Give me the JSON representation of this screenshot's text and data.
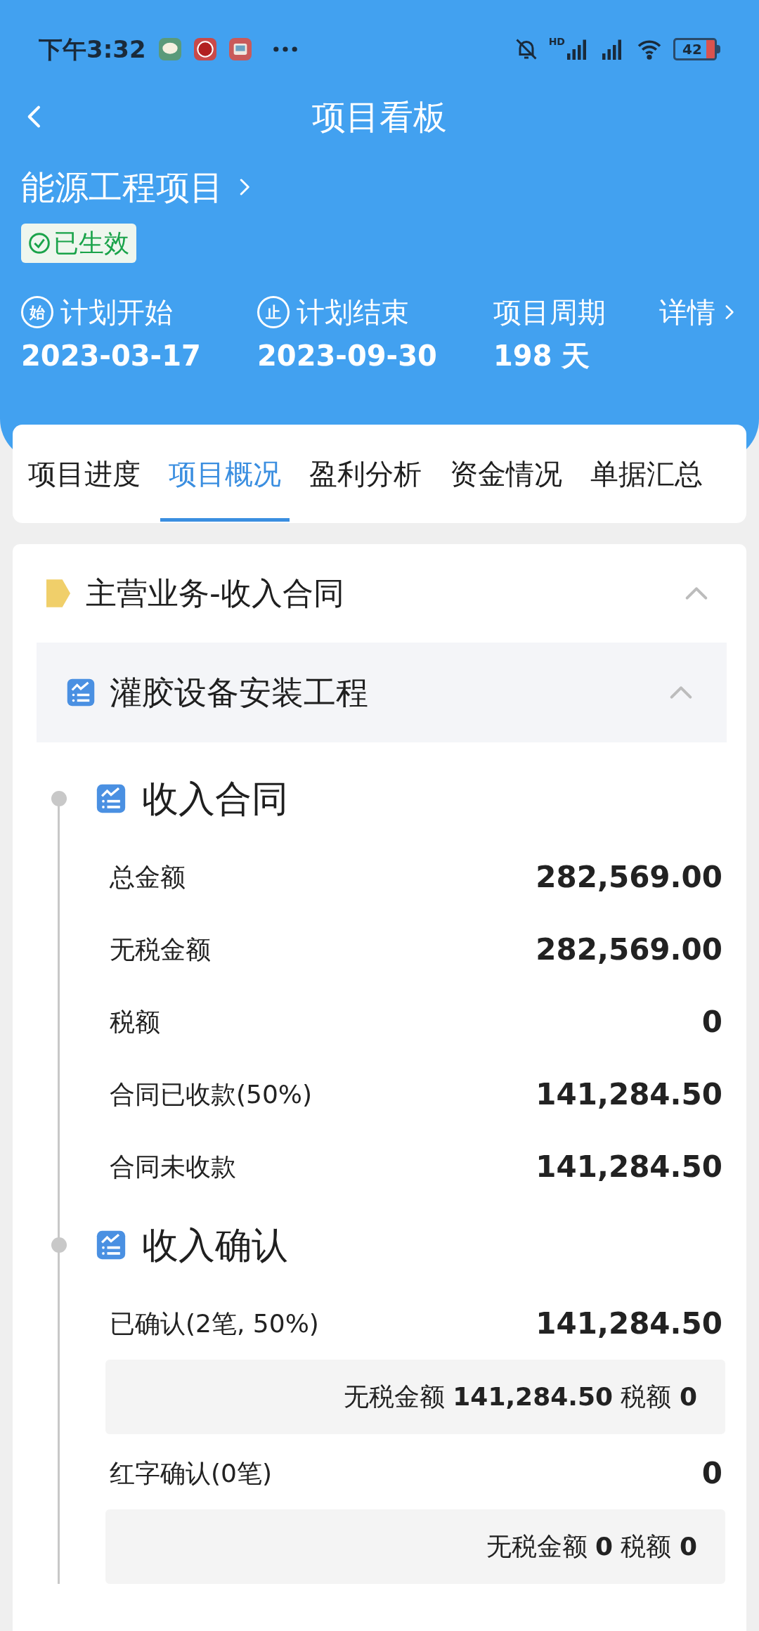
{
  "status_bar": {
    "time": "下午3:32",
    "battery": "42",
    "network_label": "HD"
  },
  "header": {
    "title": "项目看板",
    "project": "能源工程项目",
    "status": {
      "label": "已生效",
      "color": "#1aa34a"
    }
  },
  "schedule": [
    {
      "kind": "start",
      "icon_text": "始",
      "label": "计划开始",
      "value": "2023-03-17"
    },
    {
      "kind": "end",
      "icon_text": "止",
      "label": "计划结束",
      "value": "2023-09-30"
    },
    {
      "kind": "plain",
      "label": "项目周期",
      "value": "198 天"
    }
  ],
  "details_link": "详情",
  "tabs": [
    {
      "label": "项目进度",
      "selected": false
    },
    {
      "label": "项目概况",
      "selected": true
    },
    {
      "label": "盈利分析",
      "selected": false
    },
    {
      "label": "资金情况",
      "selected": false
    },
    {
      "label": "单据汇总",
      "selected": false
    }
  ],
  "section": {
    "title": "主营业务-收入合同",
    "expanded": true,
    "subsection": {
      "title": "灌胶设备安装工程",
      "expanded": true,
      "groups": [
        {
          "title": "收入合同",
          "rows": [
            {
              "label": "总金额",
              "value": "282,569.00"
            },
            {
              "label": "无税金额",
              "value": "282,569.00"
            },
            {
              "label": "税额",
              "value": "0"
            },
            {
              "label": "合同已收款(50%)",
              "value": "141,284.50"
            },
            {
              "label": "合同未收款",
              "value": "141,284.50"
            }
          ]
        },
        {
          "title": "收入确认",
          "rows": [
            {
              "label": "已确认(2笔, 50%)",
              "value": "141,284.50",
              "detail": "无税金额 **141,284.50** 税额 **0**"
            },
            {
              "label": "红字确认(0笔)",
              "value": "0",
              "detail": "无税金额 **0** 税额 **0**"
            }
          ]
        }
      ]
    }
  }
}
